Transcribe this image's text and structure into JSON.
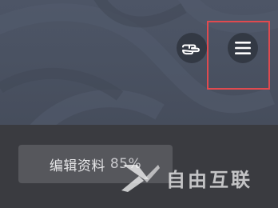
{
  "header": {
    "gesture_icon": "hand-pointing-icon",
    "menu_icon": "hamburger-menu-icon"
  },
  "profile": {
    "edit_label": "编辑资料",
    "completion": "85%"
  },
  "watermark": {
    "text": "自由互联",
    "logo_icon": "x-logo-icon"
  },
  "colors": {
    "highlight": "#e04a4f",
    "cover_bg": "#4a5262",
    "page_bg": "#3a3b40",
    "button_bg": "#56575c"
  }
}
